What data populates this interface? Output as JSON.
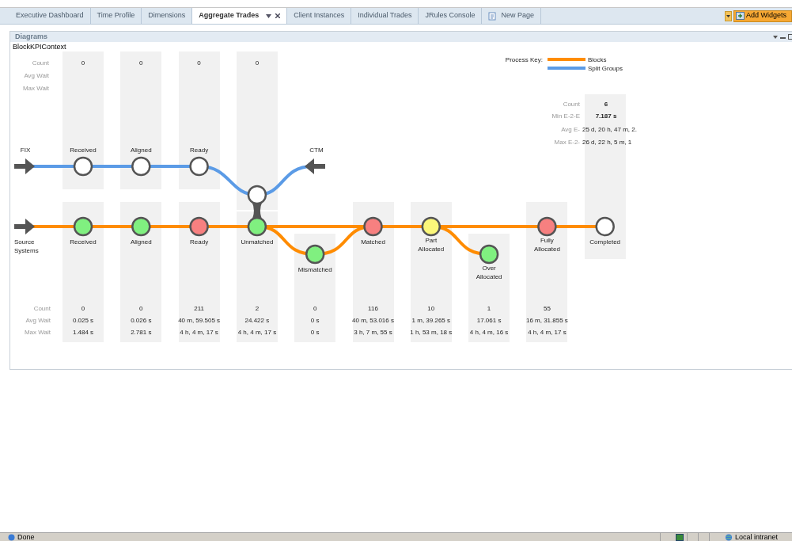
{
  "tabs": [
    {
      "label": "Executive Dashboard",
      "selected": false,
      "closable": false,
      "kind": "tab"
    },
    {
      "label": "Time Profile",
      "selected": false,
      "closable": false,
      "kind": "tab"
    },
    {
      "label": "Dimensions",
      "selected": false,
      "closable": false,
      "kind": "tab"
    },
    {
      "label": "Aggregate Trades",
      "selected": true,
      "closable": true,
      "kind": "tab"
    },
    {
      "label": "Client Instances",
      "selected": false,
      "closable": false,
      "kind": "tab"
    },
    {
      "label": "Individual Trades",
      "selected": false,
      "closable": false,
      "kind": "tab"
    },
    {
      "label": "JRules Console",
      "selected": false,
      "closable": false,
      "kind": "tab"
    },
    {
      "label": "New Page",
      "selected": false,
      "closable": false,
      "kind": "new_page"
    }
  ],
  "add_widgets": {
    "label": "Add Widgets"
  },
  "panel": {
    "title": "Diagrams",
    "context": "BlockKPIContext",
    "process_key": {
      "label": "Process Key:",
      "items": [
        {
          "label": "Blocks",
          "color": "#ff8c00"
        },
        {
          "label": "Split Groups",
          "color": "#5b9be6"
        }
      ]
    },
    "split_groups": {
      "source": "FIX",
      "entry": "CTM",
      "stat_labels": [
        "Count",
        "Avg Wait",
        "Max Wait"
      ],
      "stages": [
        {
          "label": "Received",
          "count": "0",
          "color": "#ffffff"
        },
        {
          "label": "Aligned",
          "count": "0",
          "color": "#ffffff"
        },
        {
          "label": "Ready",
          "count": "0",
          "color": "#ffffff"
        },
        {
          "count": "0",
          "color": "#ffffff"
        }
      ]
    },
    "blocks": {
      "source": "Source Systems",
      "stat_labels": [
        "Count",
        "Avg Wait",
        "Max Wait"
      ],
      "stages": [
        {
          "label": "Received",
          "kind": "main",
          "color": "#80f080",
          "count": "0",
          "avg_wait": "0.025 s",
          "max_wait": "1.484 s"
        },
        {
          "label": "Aligned",
          "kind": "main",
          "color": "#80f080",
          "count": "0",
          "avg_wait": "0.026 s",
          "max_wait": "2.781 s"
        },
        {
          "label": "Ready",
          "kind": "main",
          "color": "#f78080",
          "count": "211",
          "avg_wait": "40 m, 59.505 s",
          "max_wait": "4 h, 4 m, 17 s"
        },
        {
          "label": "Unmatched",
          "kind": "main",
          "color": "#80f080",
          "count": "2",
          "avg_wait": "24.422 s",
          "max_wait": "4 h, 4 m, 17 s"
        },
        {
          "label": "Mismatched",
          "kind": "loop",
          "color": "#80f080",
          "count": "0",
          "avg_wait": "0 s",
          "max_wait": "0 s"
        },
        {
          "label": "Matched",
          "kind": "main",
          "color": "#f78080",
          "count": "116",
          "avg_wait": "40 m, 53.016 s",
          "max_wait": "3 h, 7 m, 55 s"
        },
        {
          "label": "Part\nAllocated",
          "kind": "main",
          "color": "#fbf77a",
          "count": "10",
          "avg_wait": "1 m, 39.265 s",
          "max_wait": "1 h, 53 m, 18 s"
        },
        {
          "label": "Over\nAllocated",
          "kind": "spur",
          "color": "#80f080",
          "count": "1",
          "avg_wait": "17.061 s",
          "max_wait": "4 h, 4 m, 16 s"
        },
        {
          "label": "Fully\nAllocated",
          "kind": "main",
          "color": "#f78080",
          "count": "55",
          "avg_wait": "16 m, 31.855 s",
          "max_wait": "4 h, 4 m, 17 s"
        }
      ],
      "completed": {
        "label": "Completed",
        "color": "#ffffff",
        "stats": [
          {
            "label": "Count",
            "value": "6"
          },
          {
            "label": "Min E-2-E",
            "value": "7.187 s"
          },
          {
            "label": "Avg E-",
            "value": "25 d, 20 h, 47 m, 2."
          },
          {
            "label": "Max E-2-",
            "value": "26 d, 22 h, 5 m, 1"
          }
        ]
      }
    }
  },
  "status_bar": {
    "text": "Done",
    "zone": "Local intranet"
  }
}
